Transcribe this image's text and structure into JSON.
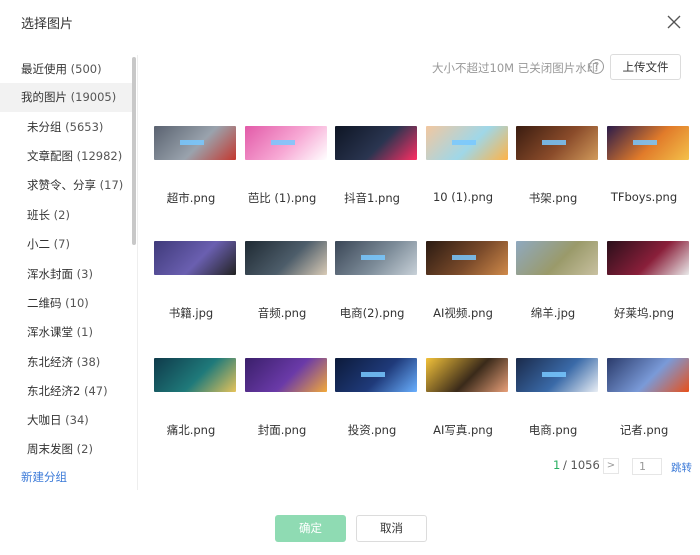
{
  "dialog": {
    "title": "选择图片"
  },
  "sidebar": {
    "items": [
      {
        "label": "最近使用",
        "count": "(500)",
        "level": "top",
        "active": false
      },
      {
        "label": "我的图片",
        "count": "(19005)",
        "level": "top",
        "active": true
      },
      {
        "label": "未分组",
        "count": "(5653)",
        "level": "sub",
        "active": false
      },
      {
        "label": "文章配图",
        "count": "(12982)",
        "level": "sub",
        "active": false
      },
      {
        "label": "求赞令、分享",
        "count": "(17)",
        "level": "sub",
        "active": false
      },
      {
        "label": "班长",
        "count": "(2)",
        "level": "sub",
        "active": false
      },
      {
        "label": "小二",
        "count": "(7)",
        "level": "sub",
        "active": false
      },
      {
        "label": "浑水封面",
        "count": "(3)",
        "level": "sub",
        "active": false
      },
      {
        "label": "二维码",
        "count": "(10)",
        "level": "sub",
        "active": false
      },
      {
        "label": "浑水课堂",
        "count": "(1)",
        "level": "sub",
        "active": false
      },
      {
        "label": "东北经济",
        "count": "(38)",
        "level": "sub",
        "active": false
      },
      {
        "label": "东北经济2",
        "count": "(47)",
        "level": "sub",
        "active": false
      },
      {
        "label": "大咖日",
        "count": "(34)",
        "level": "sub",
        "active": false
      },
      {
        "label": "周末发图",
        "count": "(2)",
        "level": "sub",
        "active": false
      }
    ],
    "new_group_label": "新建分组"
  },
  "toolbar": {
    "hint": "大小不超过10M 已关闭图片水印",
    "help_glyph": "?",
    "upload_label": "上传文件"
  },
  "images": [
    {
      "name": "超市.png",
      "colors": [
        "#5a6270",
        "#9aa3ad",
        "#c4372e"
      ],
      "band": true
    },
    {
      "name": "芭比 (1).png",
      "colors": [
        "#e25aa8",
        "#f7a8d4",
        "#ffffff"
      ],
      "band": true
    },
    {
      "name": "抖音1.png",
      "colors": [
        "#0e1524",
        "#2a3550",
        "#ff2e63"
      ],
      "band": false
    },
    {
      "name": "10 (1).png",
      "colors": [
        "#f2c7a0",
        "#9fd7e8",
        "#ffb347"
      ],
      "band": true
    },
    {
      "name": "书架.png",
      "colors": [
        "#3a1c10",
        "#8a4b2a",
        "#d19a5b"
      ],
      "band": true
    },
    {
      "name": "TFboys.png",
      "colors": [
        "#2a1b4a",
        "#e17b2a",
        "#f4c14a"
      ],
      "band": true
    },
    {
      "name": "书籍.jpg",
      "colors": [
        "#3f3a7a",
        "#6a5fb0",
        "#222222"
      ],
      "band": false
    },
    {
      "name": "音频.png",
      "colors": [
        "#1f2a33",
        "#4d5d6a",
        "#d9cbb6"
      ],
      "band": false
    },
    {
      "name": "电商(2).png",
      "colors": [
        "#3a4656",
        "#7d8c99",
        "#c8d1d8"
      ],
      "band": true
    },
    {
      "name": "AI视频.png",
      "colors": [
        "#2a1a12",
        "#7a4a2a",
        "#d08a4a"
      ],
      "band": true
    },
    {
      "name": "绵羊.jpg",
      "colors": [
        "#8fa9c0",
        "#9a9a6a",
        "#c8c0a0"
      ],
      "band": false
    },
    {
      "name": "好莱坞.png",
      "colors": [
        "#2a0f1a",
        "#8a1f3a",
        "#e9e9e9"
      ],
      "band": false
    },
    {
      "name": "痛北.png",
      "colors": [
        "#0f3a4a",
        "#1f7a7a",
        "#e6c35a"
      ],
      "band": false
    },
    {
      "name": "封面.png",
      "colors": [
        "#3a1f6a",
        "#6a3aa8",
        "#f2a93a"
      ],
      "band": false
    },
    {
      "name": "投资.png",
      "colors": [
        "#0c1a3a",
        "#1f3a7a",
        "#6ab0ff"
      ],
      "band": true
    },
    {
      "name": "AI写真.png",
      "colors": [
        "#f2c23a",
        "#3a2a1a",
        "#e9a07a"
      ],
      "band": false
    },
    {
      "name": "电商.png",
      "colors": [
        "#1a2a4a",
        "#3a6aa8",
        "#e9eef5"
      ],
      "band": true
    },
    {
      "name": "记者.png",
      "colors": [
        "#2a3a6a",
        "#7a9ad8",
        "#e8501a"
      ],
      "band": false
    }
  ],
  "pagination": {
    "current": "1",
    "total": "/ 1056",
    "next_glyph": ">",
    "jump_value": "1",
    "jump_label": "跳转"
  },
  "footer": {
    "ok_label": "确定",
    "cancel_label": "取消"
  },
  "colors": {
    "accent": "#27ae60",
    "ok_disabled": "#8fdbb3",
    "link": "#3b7ad8"
  }
}
